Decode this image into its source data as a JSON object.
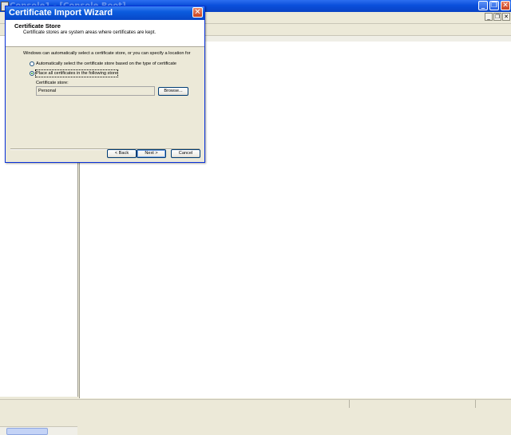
{
  "background_window": {
    "title": "Console1 - [Console Root]",
    "controls": {
      "minimize": "_",
      "maximize": "❐",
      "close": "✕"
    },
    "child_controls": {
      "minimize": "_",
      "restore": "❐",
      "close": "✕"
    }
  },
  "dialog": {
    "title": "Certificate Import Wizard",
    "close_glyph": "✕",
    "header": {
      "title": "Certificate Store",
      "subtitle": "Certificate stores are system areas where certificates are kept."
    },
    "intro": "Windows can automatically select a certificate store, or you can specify a location for",
    "options": [
      {
        "label": "Automatically select the certificate store based on the type of certificate",
        "checked": false
      },
      {
        "label": "Place all certificates in the following store",
        "checked": true
      }
    ],
    "store_label": "Certificate store:",
    "store_value": "Personal",
    "browse_label": "Browse...",
    "buttons": {
      "back": "< Back",
      "next": "Next >",
      "cancel": "Cancel"
    }
  }
}
